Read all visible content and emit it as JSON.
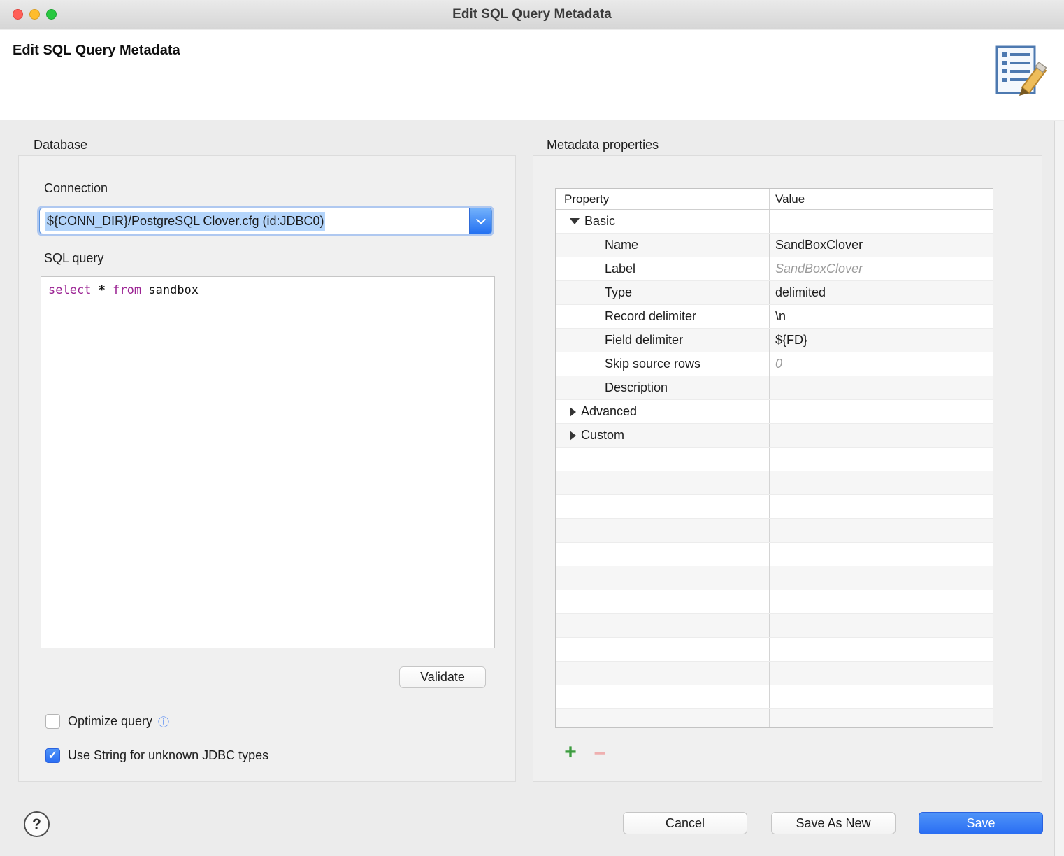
{
  "window": {
    "title": "Edit SQL Query Metadata"
  },
  "header": {
    "title": "Edit SQL Query Metadata"
  },
  "database": {
    "section_label": "Database",
    "connection_label": "Connection",
    "connection_value": "${CONN_DIR}/PostgreSQL Clover.cfg (id:JDBC0)",
    "sql_label": "SQL query",
    "sql": {
      "kw1": "select",
      "star": "*",
      "kw2": "from",
      "ident": "sandbox"
    },
    "validate_label": "Validate",
    "optimize_label": "Optimize query",
    "use_string_label": "Use String for unknown JDBC types"
  },
  "metadata": {
    "section_label": "Metadata properties",
    "columns": {
      "property": "Property",
      "value": "Value"
    },
    "rows": [
      {
        "property": "Basic",
        "value": ""
      },
      {
        "property": "Name",
        "value": "SandBoxClover"
      },
      {
        "property": "Label",
        "value": "SandBoxClover"
      },
      {
        "property": "Type",
        "value": "delimited"
      },
      {
        "property": "Record delimiter",
        "value": "\\n"
      },
      {
        "property": "Field delimiter",
        "value": "${FD}"
      },
      {
        "property": "Skip source rows",
        "value": "0"
      },
      {
        "property": "Description",
        "value": ""
      },
      {
        "property": "Advanced",
        "value": ""
      },
      {
        "property": "Custom",
        "value": ""
      }
    ]
  },
  "icons": {
    "add": "+",
    "remove": "−",
    "info": "ⓘ"
  },
  "footer": {
    "help": "?",
    "cancel": "Cancel",
    "save_as_new": "Save As New",
    "save": "Save"
  }
}
